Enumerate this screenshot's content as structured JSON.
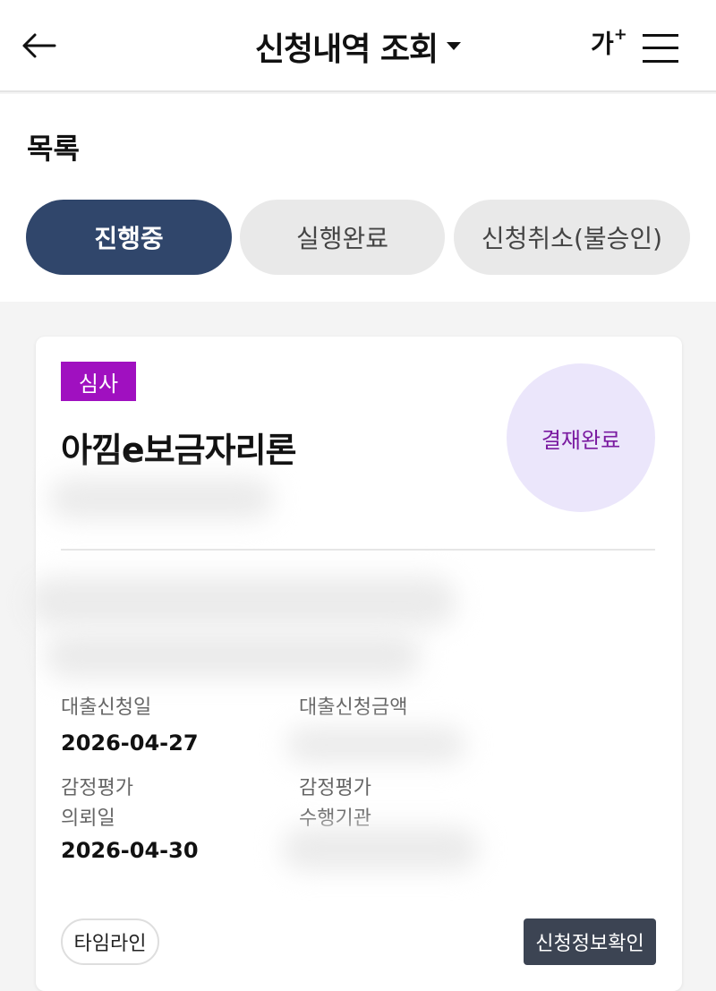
{
  "header": {
    "title": "신청내역 조회",
    "font_size_label": "가",
    "font_size_plus": "+"
  },
  "filter": {
    "section_title": "목록",
    "tabs": [
      {
        "label": "진행중",
        "active": true
      },
      {
        "label": "실행완료",
        "active": false
      },
      {
        "label": "신청취소(불승인)",
        "active": false
      }
    ]
  },
  "card": {
    "badge": "심사",
    "product_name": "아낌e보금자리론",
    "status": "결재완료",
    "loan_application_date_label": "대출신청일",
    "loan_application_date": "2026-04-27",
    "loan_amount_label": "대출신청금액",
    "appraisal_request_label_line1": "감정평가",
    "appraisal_request_label_line2": "의뢰일",
    "appraisal_request_date": "2026-04-30",
    "appraisal_agency_label_line1": "감정평가",
    "appraisal_agency_label_line2": "수행기관",
    "timeline_button": "타임라인",
    "confirm_button": "신청정보확인"
  },
  "colors": {
    "active_tab": "#30466b",
    "badge": "#a010c0",
    "status_circle": "#ebe6fb",
    "status_text": "#7a1aa0",
    "confirm_button": "#3c4453"
  }
}
